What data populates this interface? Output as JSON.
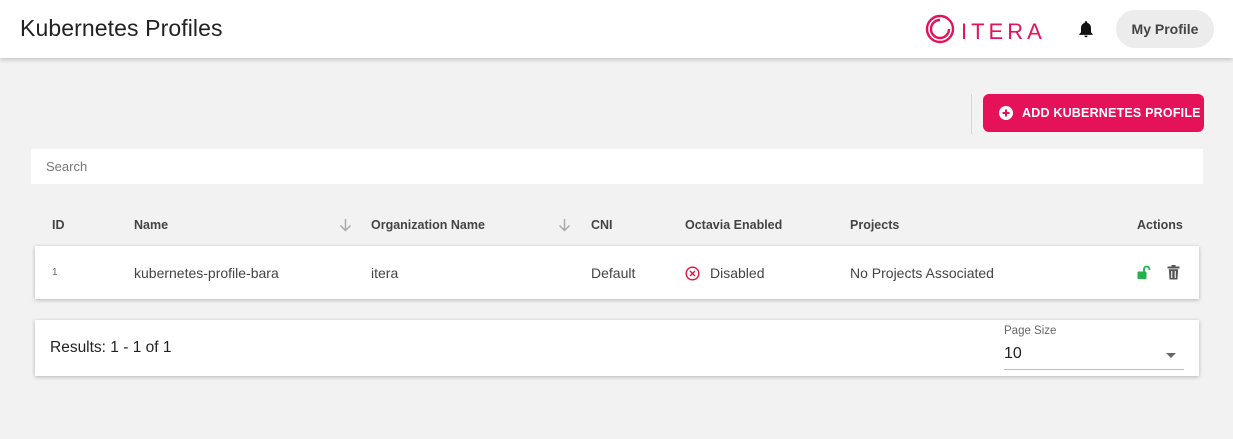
{
  "header": {
    "title": "Kubernetes Profiles",
    "logo_text": "ITERA",
    "profile_label": "My Profile"
  },
  "colors": {
    "brand": "#e5125a",
    "unlock": "#22b14c",
    "disabled": "#d9153b"
  },
  "toolbar": {
    "add_label": "ADD KUBERNETES PROFILE"
  },
  "search": {
    "placeholder": "Search"
  },
  "table": {
    "columns": {
      "id": "ID",
      "name": "Name",
      "organization": "Organization Name",
      "cni": "CNI",
      "octavia": "Octavia Enabled",
      "projects": "Projects",
      "actions": "Actions"
    },
    "rows": [
      {
        "id": "1",
        "name": "kubernetes-profile-bara",
        "organization": "itera",
        "cni": "Default",
        "octavia": "Disabled",
        "projects": "No Projects Associated"
      }
    ]
  },
  "pagination": {
    "results": "Results: 1 - 1 of 1",
    "page_size_label": "Page Size",
    "page_size": "10"
  }
}
